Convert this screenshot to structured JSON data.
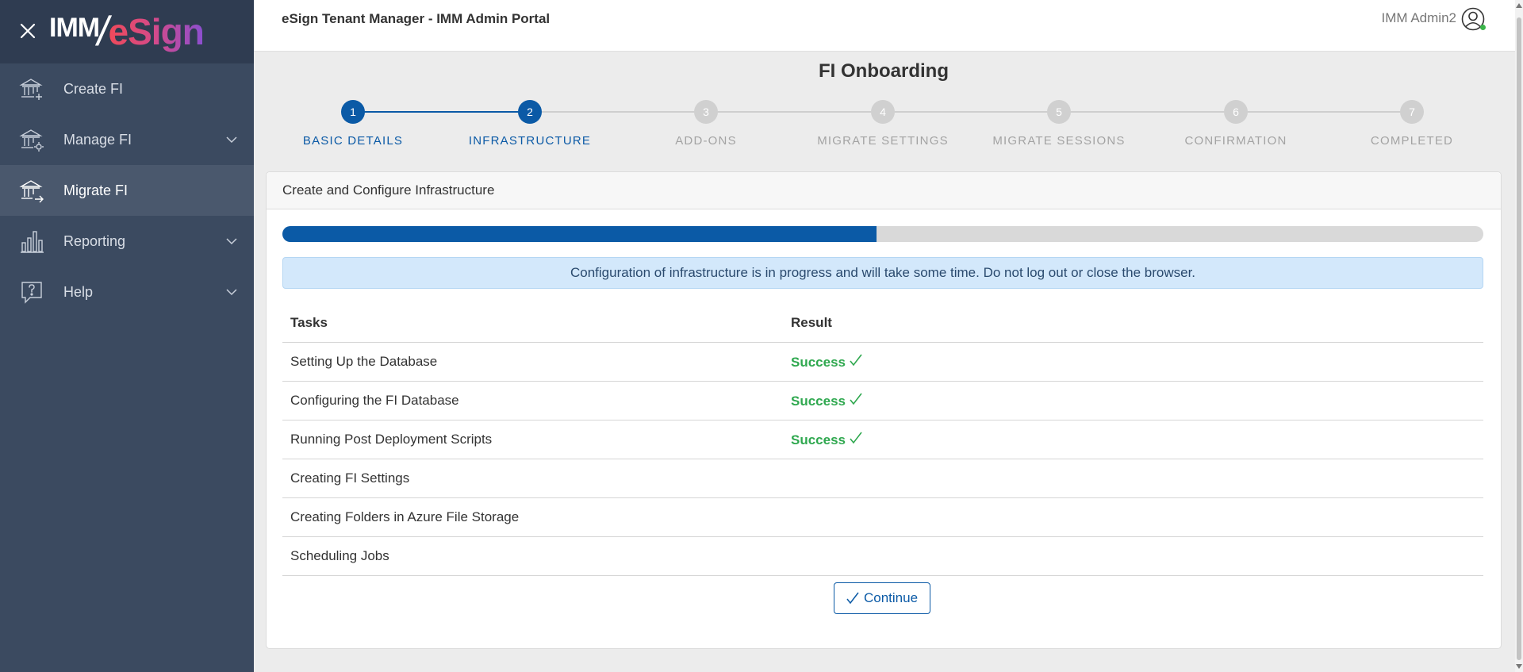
{
  "brand": {
    "imm": "IMM",
    "esign": "eSign"
  },
  "sidebar": {
    "items": [
      {
        "label": "Create FI",
        "icon": "bank-plus-icon",
        "expandable": false,
        "active": false
      },
      {
        "label": "Manage FI",
        "icon": "bank-gear-icon",
        "expandable": true,
        "active": false
      },
      {
        "label": "Migrate FI",
        "icon": "bank-arrow-icon",
        "expandable": false,
        "active": true
      },
      {
        "label": "Reporting",
        "icon": "bar-chart-icon",
        "expandable": true,
        "active": false
      },
      {
        "label": "Help",
        "icon": "help-bubble-icon",
        "expandable": true,
        "active": false
      }
    ]
  },
  "header": {
    "title": "eSign Tenant Manager - IMM Admin Portal",
    "user": "IMM Admin2"
  },
  "page": {
    "title": "FI Onboarding"
  },
  "stepper": {
    "steps": [
      {
        "number": "1",
        "label": "BASIC DETAILS",
        "active": true
      },
      {
        "number": "2",
        "label": "INFRASTRUCTURE",
        "active": true
      },
      {
        "number": "3",
        "label": "ADD-ONS",
        "active": false
      },
      {
        "number": "4",
        "label": "MIGRATE SETTINGS",
        "active": false
      },
      {
        "number": "5",
        "label": "MIGRATE SESSIONS",
        "active": false
      },
      {
        "number": "6",
        "label": "CONFIRMATION",
        "active": false
      },
      {
        "number": "7",
        "label": "COMPLETED",
        "active": false
      }
    ]
  },
  "card": {
    "title": "Create and Configure Infrastructure",
    "progress": 0.495,
    "alert": "Configuration of infrastructure is in progress and will take some time. Do not log out or close the browser.",
    "table": {
      "headers": {
        "task": "Tasks",
        "result": "Result"
      },
      "rows": [
        {
          "task": "Setting Up the Database",
          "result": "Success"
        },
        {
          "task": "Configuring the FI Database",
          "result": "Success"
        },
        {
          "task": "Running Post Deployment Scripts",
          "result": "Success"
        },
        {
          "task": "Creating FI Settings",
          "result": ""
        },
        {
          "task": "Creating Folders in Azure File Storage",
          "result": ""
        },
        {
          "task": "Scheduling Jobs",
          "result": ""
        }
      ]
    },
    "continue_label": "Continue"
  },
  "colors": {
    "sidebar": "#3b4a60",
    "sidebar_header": "#2f3c51",
    "primary": "#0b5aa6",
    "success": "#2fa84f",
    "alert_bg": "#d3e8fb"
  }
}
